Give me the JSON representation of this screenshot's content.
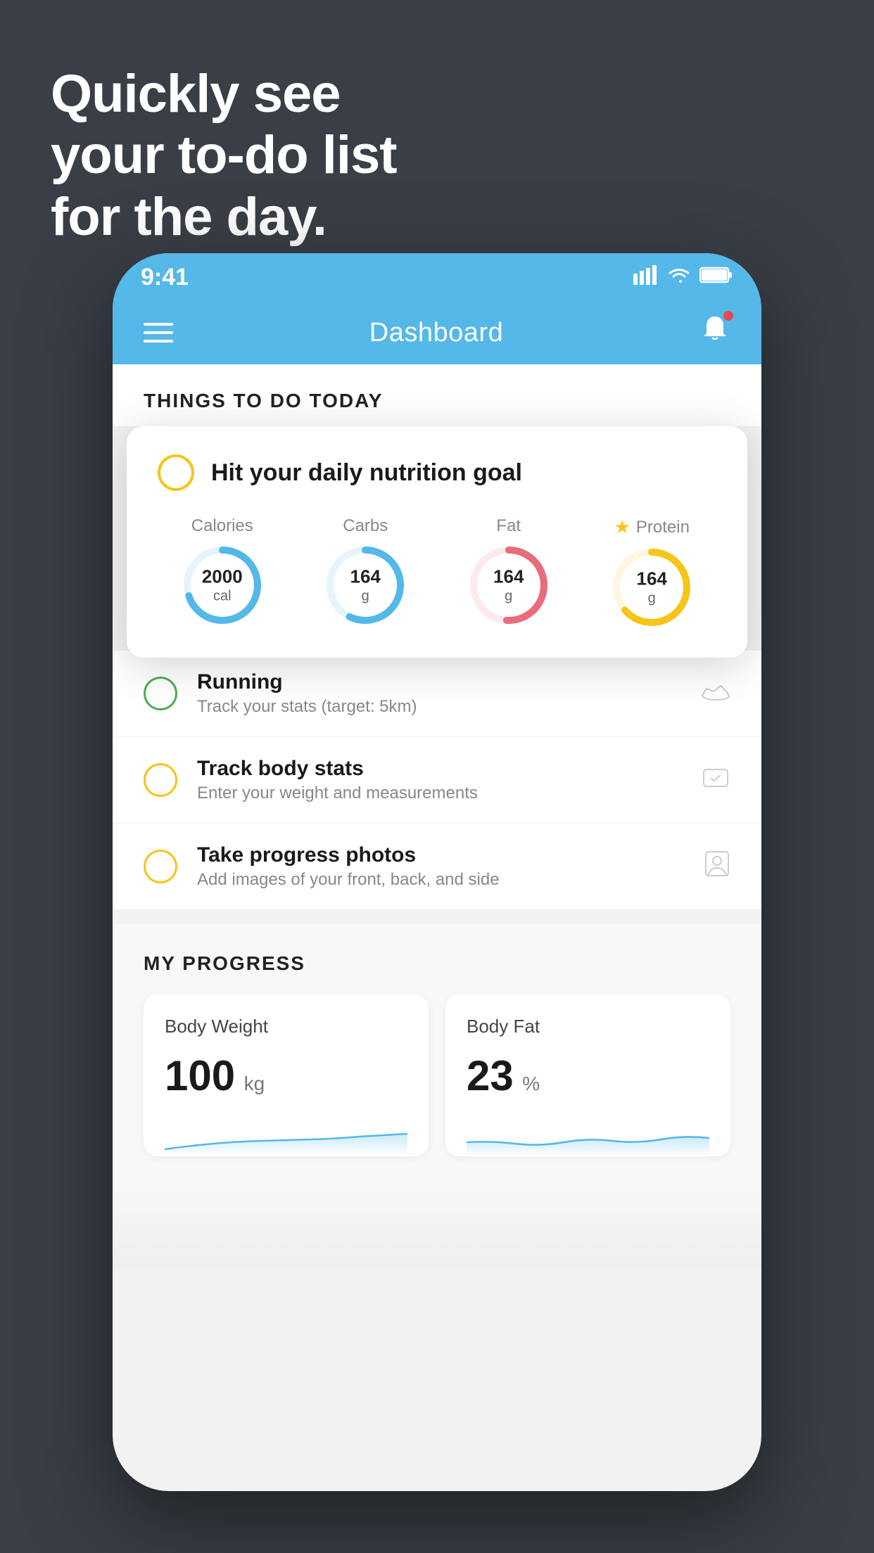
{
  "background": {
    "color": "#3a3f47"
  },
  "headline": {
    "line1": "Quickly see",
    "line2": "your to-do list",
    "line3": "for the day."
  },
  "phone": {
    "statusBar": {
      "time": "9:41",
      "signal": "▋▋▋▋",
      "wifi": "WiFi",
      "battery": "Battery"
    },
    "navbar": {
      "title": "Dashboard",
      "menuIcon": "hamburger",
      "notificationIcon": "bell"
    },
    "sectionTitle": "THINGS TO DO TODAY",
    "nutritionCard": {
      "checkIcon": "circle",
      "title": "Hit your daily nutrition goal",
      "goals": [
        {
          "label": "Calories",
          "value": "2000",
          "unit": "cal",
          "color": "#54b8e8",
          "starred": false
        },
        {
          "label": "Carbs",
          "value": "164",
          "unit": "g",
          "color": "#54b8e8",
          "starred": false
        },
        {
          "label": "Fat",
          "value": "164",
          "unit": "g",
          "color": "#e86c7a",
          "starred": false
        },
        {
          "label": "Protein",
          "value": "164",
          "unit": "g",
          "color": "#f5c518",
          "starred": true
        }
      ]
    },
    "todoItems": [
      {
        "title": "Running",
        "subtitle": "Track your stats (target: 5km)",
        "circleColor": "green",
        "iconType": "shoe"
      },
      {
        "title": "Track body stats",
        "subtitle": "Enter your weight and measurements",
        "circleColor": "yellow",
        "iconType": "scale"
      },
      {
        "title": "Take progress photos",
        "subtitle": "Add images of your front, back, and side",
        "circleColor": "yellow",
        "iconType": "portrait"
      }
    ],
    "progressSection": {
      "title": "MY PROGRESS",
      "cards": [
        {
          "title": "Body Weight",
          "value": "100",
          "unit": "kg"
        },
        {
          "title": "Body Fat",
          "value": "23",
          "unit": "%"
        }
      ]
    }
  }
}
